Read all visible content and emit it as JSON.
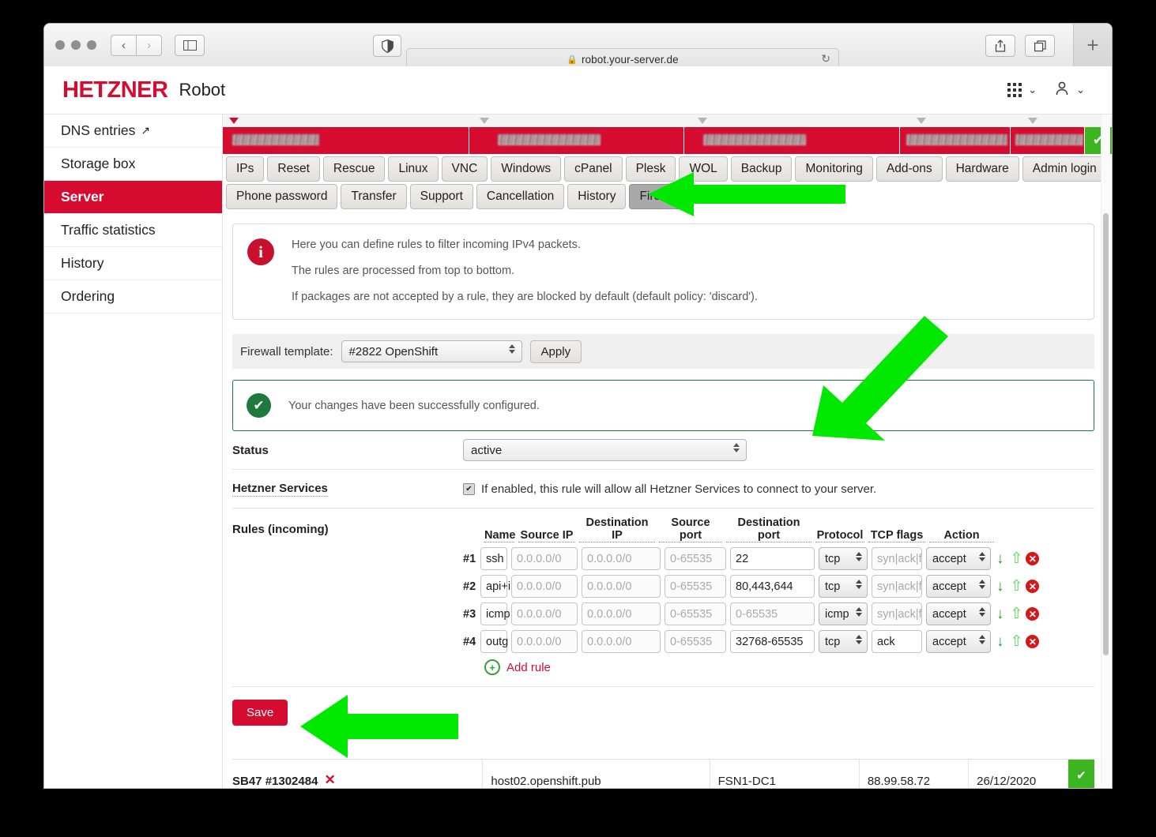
{
  "browser": {
    "url": "robot.your-server.de",
    "lock_icon": "lock-icon",
    "back_icon": "‹",
    "forward_icon": "›",
    "sidebar_icon": "sidebar-icon",
    "shield_icon": "privacy-shield-icon",
    "reload_icon": "↻",
    "share_icon": "share-icon",
    "tabs_icon": "tab-overview-icon",
    "newtab_label": "+"
  },
  "header": {
    "logo": "HETZNER",
    "product": "Robot",
    "apps_icon": "grid-apps-icon",
    "account_icon": "user-account-icon",
    "chevron": "⌄"
  },
  "sidebar": {
    "items": [
      {
        "label": "DNS entries",
        "external": true,
        "active": false
      },
      {
        "label": "Storage box",
        "external": false,
        "active": false
      },
      {
        "label": "Server",
        "external": false,
        "active": true
      },
      {
        "label": "Traffic statistics",
        "external": false,
        "active": false
      },
      {
        "label": "History",
        "external": false,
        "active": false
      },
      {
        "label": "Ordering",
        "external": false,
        "active": false
      }
    ],
    "external_icon": "↗"
  },
  "server_row": {
    "redacted_cells": [
      "redacted",
      "redacted",
      "redacted",
      "redacted",
      "redacted"
    ],
    "status_icon": "check-icon"
  },
  "tabs": {
    "row1": [
      "IPs",
      "Reset",
      "Rescue",
      "Linux",
      "VNC",
      "Windows",
      "cPanel",
      "Plesk",
      "WOL",
      "Backup",
      "Monitoring",
      "Add-ons",
      "Hardware",
      "Admin login"
    ],
    "row2": [
      "Phone password",
      "Transfer",
      "Support",
      "Cancellation",
      "History",
      "Firewall"
    ],
    "selected": "Firewall"
  },
  "info": {
    "icon": "info-icon",
    "lines": [
      "Here you can define rules to filter incoming IPv4 packets.",
      "The rules are processed from top to bottom.",
      "If packages are not accepted by a rule, they are blocked by default (default policy: 'discard')."
    ]
  },
  "template_bar": {
    "label": "Firewall template:",
    "selected": "#2822 OpenShift",
    "apply_label": "Apply"
  },
  "success": {
    "icon": "success-check-icon",
    "message": "Your changes have been successfully configured."
  },
  "status_row": {
    "label": "Status",
    "value": "active"
  },
  "hetzner_services": {
    "label": "Hetzner Services",
    "checked": true,
    "text": "If enabled, this rule will allow all Hetzner Services to connect to your server."
  },
  "rules": {
    "label": "Rules (incoming)",
    "columns": [
      "Name",
      "Source IP",
      "Destination IP",
      "Source port",
      "Destination port",
      "Protocol",
      "TCP flags",
      "Action"
    ],
    "items": [
      {
        "num": "#1",
        "name": "ssh",
        "source_ip": "",
        "source_ip_ph": "0.0.0.0/0",
        "dest_ip": "",
        "dest_ip_ph": "0.0.0.0/0",
        "source_port": "",
        "source_port_ph": "0-65535",
        "dest_port": "22",
        "dest_port_ph": "0-65535",
        "protocol": "tcp",
        "tcp_flags": "",
        "tcp_flags_ph": "syn|ack|fin|rst|urg|psh|all|none",
        "action": "accept"
      },
      {
        "num": "#2",
        "name": "api+i",
        "source_ip": "",
        "source_ip_ph": "0.0.0.0/0",
        "dest_ip": "",
        "dest_ip_ph": "0.0.0.0/0",
        "source_port": "",
        "source_port_ph": "0-65535",
        "dest_port": "80,443,644",
        "dest_port_ph": "0-65535",
        "protocol": "tcp",
        "tcp_flags": "",
        "tcp_flags_ph": "syn|ack|fin|rst|urg|psh|all|none",
        "action": "accept"
      },
      {
        "num": "#3",
        "name": "icmp",
        "source_ip": "",
        "source_ip_ph": "0.0.0.0/0",
        "dest_ip": "",
        "dest_ip_ph": "0.0.0.0/0",
        "source_port": "",
        "source_port_ph": "0-65535",
        "dest_port": "",
        "dest_port_ph": "0-65535",
        "protocol": "icmp",
        "tcp_flags": "",
        "tcp_flags_ph": "syn|ack|fin|rst|urg|psh|all|none",
        "action": "accept"
      },
      {
        "num": "#4",
        "name": "outg",
        "source_ip": "",
        "source_ip_ph": "0.0.0.0/0",
        "dest_ip": "",
        "dest_ip_ph": "0.0.0.0/0",
        "source_port": "",
        "source_port_ph": "0-65535",
        "dest_port": "32768-65535",
        "dest_port_ph": "0-65535",
        "protocol": "tcp",
        "tcp_flags": "ack",
        "tcp_flags_ph": "syn|ack|fin|rst|urg|psh|all|none",
        "action": "accept"
      }
    ],
    "add_rule_label": "Add rule",
    "move_down_icon": "arrow-down-icon",
    "move_up_icon": "arrow-up-icon",
    "delete_icon": "delete-rule-icon"
  },
  "save": {
    "label": "Save"
  },
  "bottom_row": {
    "server": "SB47 #1302484",
    "collapse_icon": "✕",
    "hostname": "host02.openshift.pub",
    "datacenter": "FSN1-DC1",
    "ip": "88.99.58.72",
    "date": "26/12/2020",
    "status_icon": "check-icon"
  },
  "colors": {
    "brand_red": "#d50c2f",
    "success_green": "#1d7a3c",
    "status_green": "#3cb521",
    "annotation_green": "#00e800"
  }
}
